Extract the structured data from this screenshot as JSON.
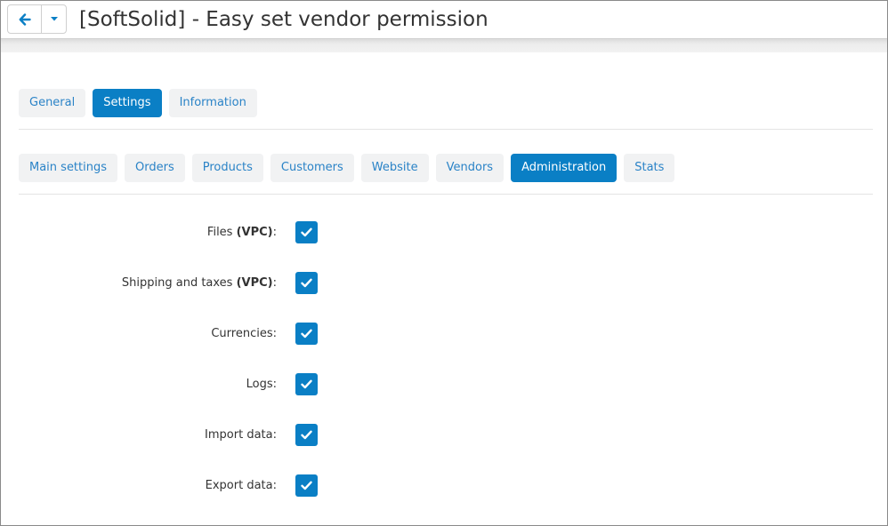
{
  "header": {
    "title": "[SoftSolid] - Easy set vendor permission"
  },
  "tabs": [
    {
      "label": "General",
      "active": false
    },
    {
      "label": "Settings",
      "active": true
    },
    {
      "label": "Information",
      "active": false
    }
  ],
  "subtabs": [
    {
      "label": "Main settings",
      "active": false
    },
    {
      "label": "Orders",
      "active": false
    },
    {
      "label": "Products",
      "active": false
    },
    {
      "label": "Customers",
      "active": false
    },
    {
      "label": "Website",
      "active": false
    },
    {
      "label": "Vendors",
      "active": false
    },
    {
      "label": "Administration",
      "active": true
    },
    {
      "label": "Stats",
      "active": false
    }
  ],
  "permissions": [
    {
      "label": "Files",
      "bold": "(VPC)",
      "suffix": ":",
      "checked": true
    },
    {
      "label": "Shipping and taxes",
      "bold": "(VPC)",
      "suffix": ":",
      "checked": true
    },
    {
      "label": "Currencies:",
      "bold": "",
      "suffix": "",
      "checked": true
    },
    {
      "label": "Logs:",
      "bold": "",
      "suffix": "",
      "checked": true
    },
    {
      "label": "Import data:",
      "bold": "",
      "suffix": "",
      "checked": true
    },
    {
      "label": "Export data:",
      "bold": "",
      "suffix": "",
      "checked": true
    }
  ],
  "icons": {
    "back": "arrow-left-icon",
    "dropdown": "caret-down-icon",
    "check": "checkmark-icon"
  },
  "colors": {
    "accent": "#0a7fc5",
    "link": "#2a83c7",
    "tab_bg": "#f1f2f3"
  }
}
